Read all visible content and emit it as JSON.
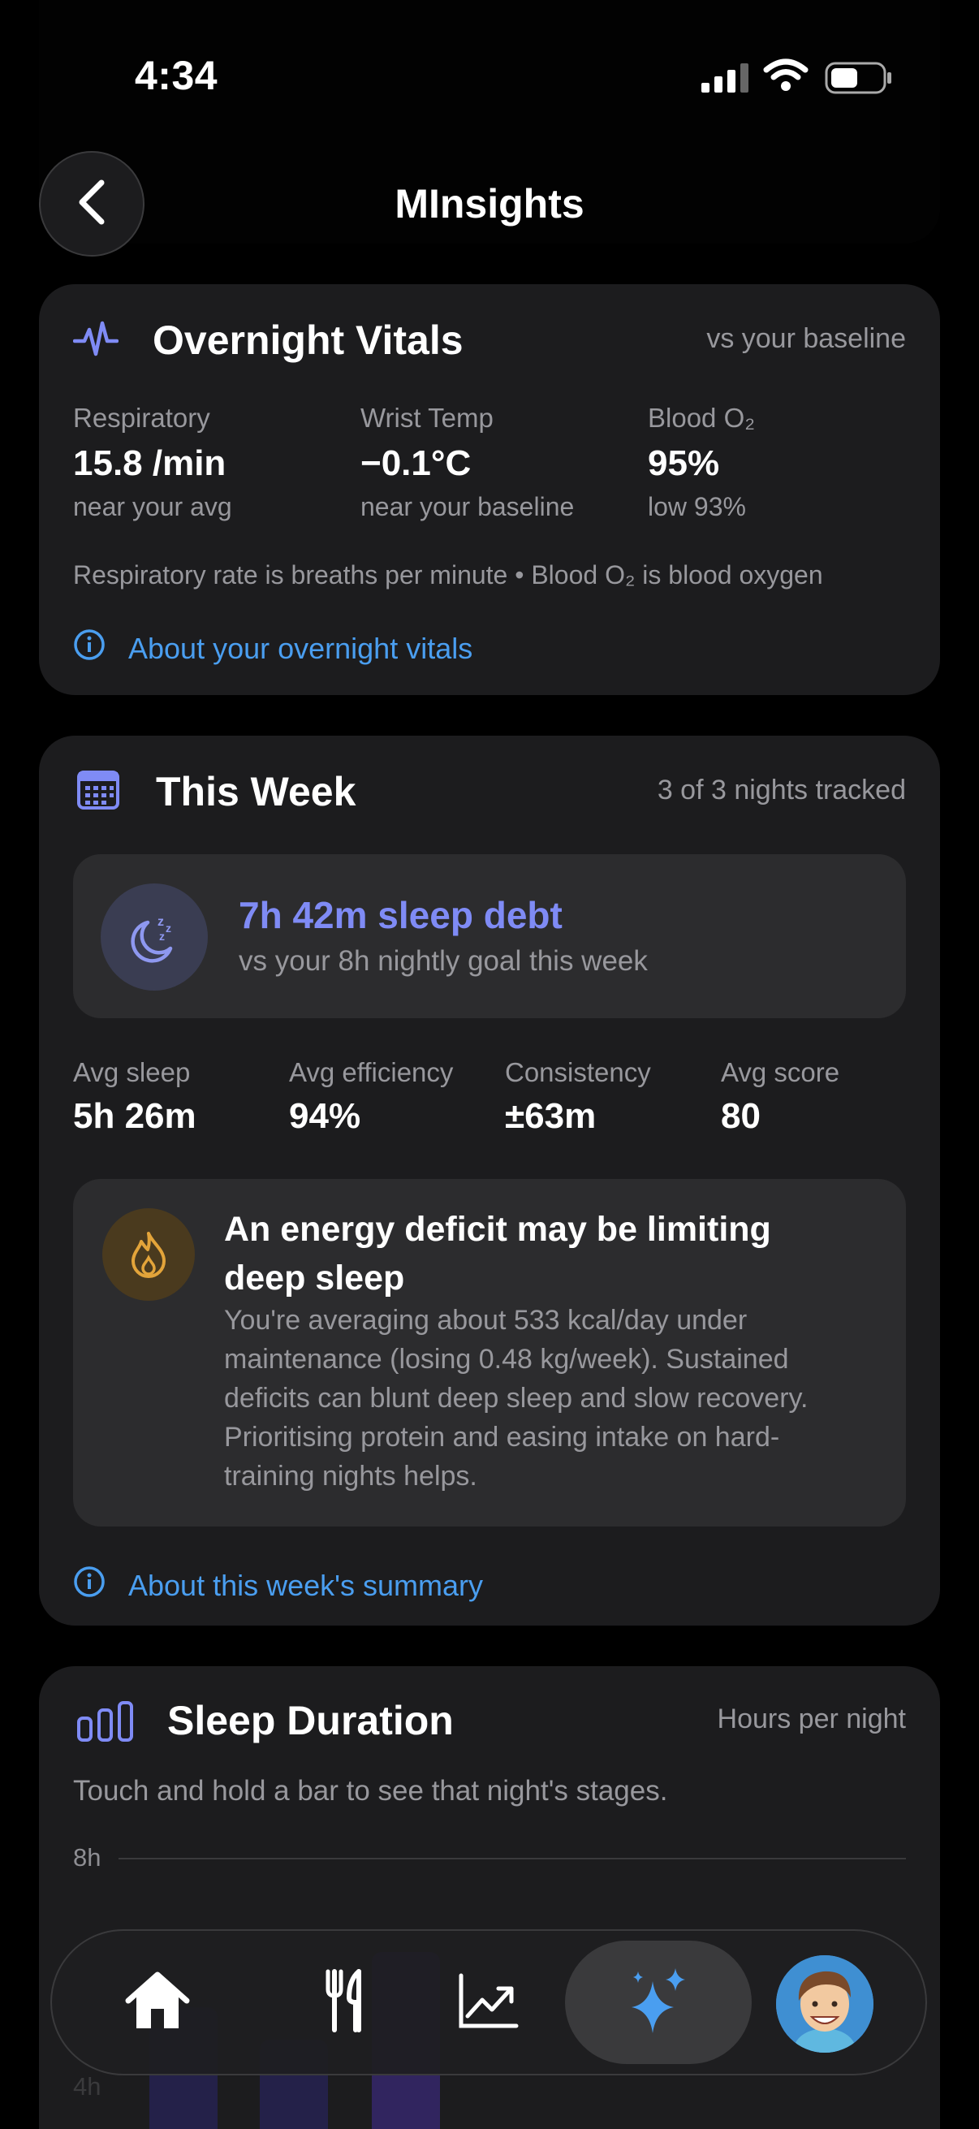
{
  "status_bar": {
    "time": "4:34"
  },
  "header": {
    "title": "MInsights"
  },
  "vitals": {
    "title": "Overnight Vitals",
    "subtitle": "vs your baseline",
    "metrics": [
      {
        "label": "Respiratory",
        "value": "15.8 /min",
        "note": "near your avg"
      },
      {
        "label": "Wrist Temp",
        "value": "−0.1°C",
        "note": "near your baseline"
      },
      {
        "label": "Blood O₂",
        "value": "95%",
        "note": "low 93%"
      }
    ],
    "footnote": "Respiratory rate is breaths per minute • Blood O₂ is blood oxygen",
    "link": "About your overnight vitals"
  },
  "week": {
    "title": "This Week",
    "subtitle": "3 of 3 nights tracked",
    "debt_title": "7h 42m sleep debt",
    "debt_sub": "vs your 8h nightly goal this week",
    "stats": [
      {
        "label": "Avg sleep",
        "value": "5h 26m"
      },
      {
        "label": "Avg efficiency",
        "value": "94%"
      },
      {
        "label": "Consistency",
        "value": "±63m"
      },
      {
        "label": "Avg score",
        "value": "80"
      }
    ],
    "energy_title": "An energy deficit may be limiting deep sleep",
    "energy_body": "You're averaging about 533 kcal/day under maintenance (losing 0.48 kg/week). Sustained deficits can blunt deep sleep and slow recovery. Prioritising protein and easing intake on hard-training nights helps.",
    "link": "About this week's summary"
  },
  "duration": {
    "title": "Sleep Duration",
    "subtitle": "Hours per night",
    "hint": "Touch and hold a bar to see that night's stages.",
    "gridline_labels": [
      "8h",
      "4h"
    ]
  },
  "colors": {
    "accent": "#4a9ef0",
    "debt": "#7f8bf5",
    "flame": "#e3a43a",
    "card": "#1c1c1e"
  },
  "tab_bar": {
    "items": [
      {
        "name": "home-icon"
      },
      {
        "name": "fork-knife-icon"
      },
      {
        "name": "chart-icon"
      },
      {
        "name": "sparkles-icon",
        "active": true
      },
      {
        "name": "avatar"
      }
    ]
  }
}
